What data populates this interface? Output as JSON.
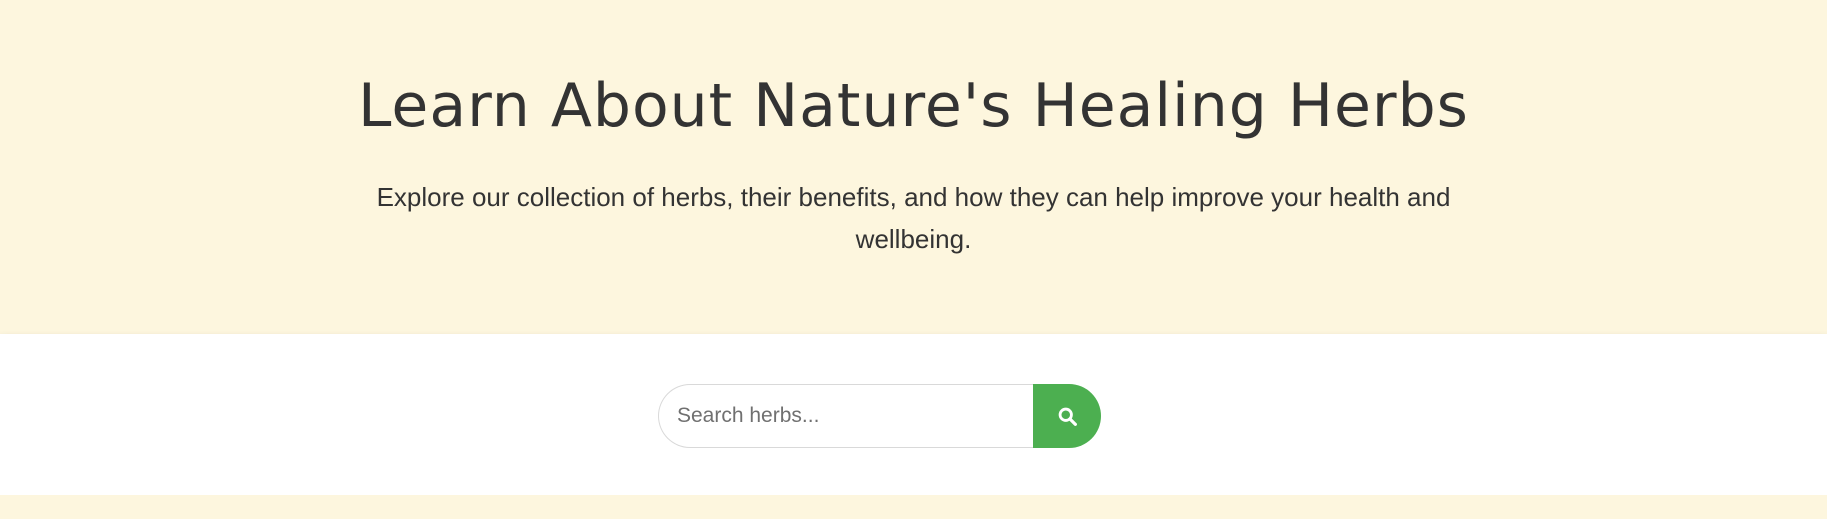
{
  "hero": {
    "title": "Learn About Nature's Healing Herbs",
    "subtitle": "Explore our collection of herbs, their benefits, and how they can help improve your health and wellbeing."
  },
  "search": {
    "placeholder": "Search herbs...",
    "value": "",
    "button_icon": "search-icon"
  },
  "colors": {
    "hero_background": "#fdf6de",
    "band_background": "#ffffff",
    "accent_green": "#4caf50",
    "text_dark": "#333333"
  }
}
